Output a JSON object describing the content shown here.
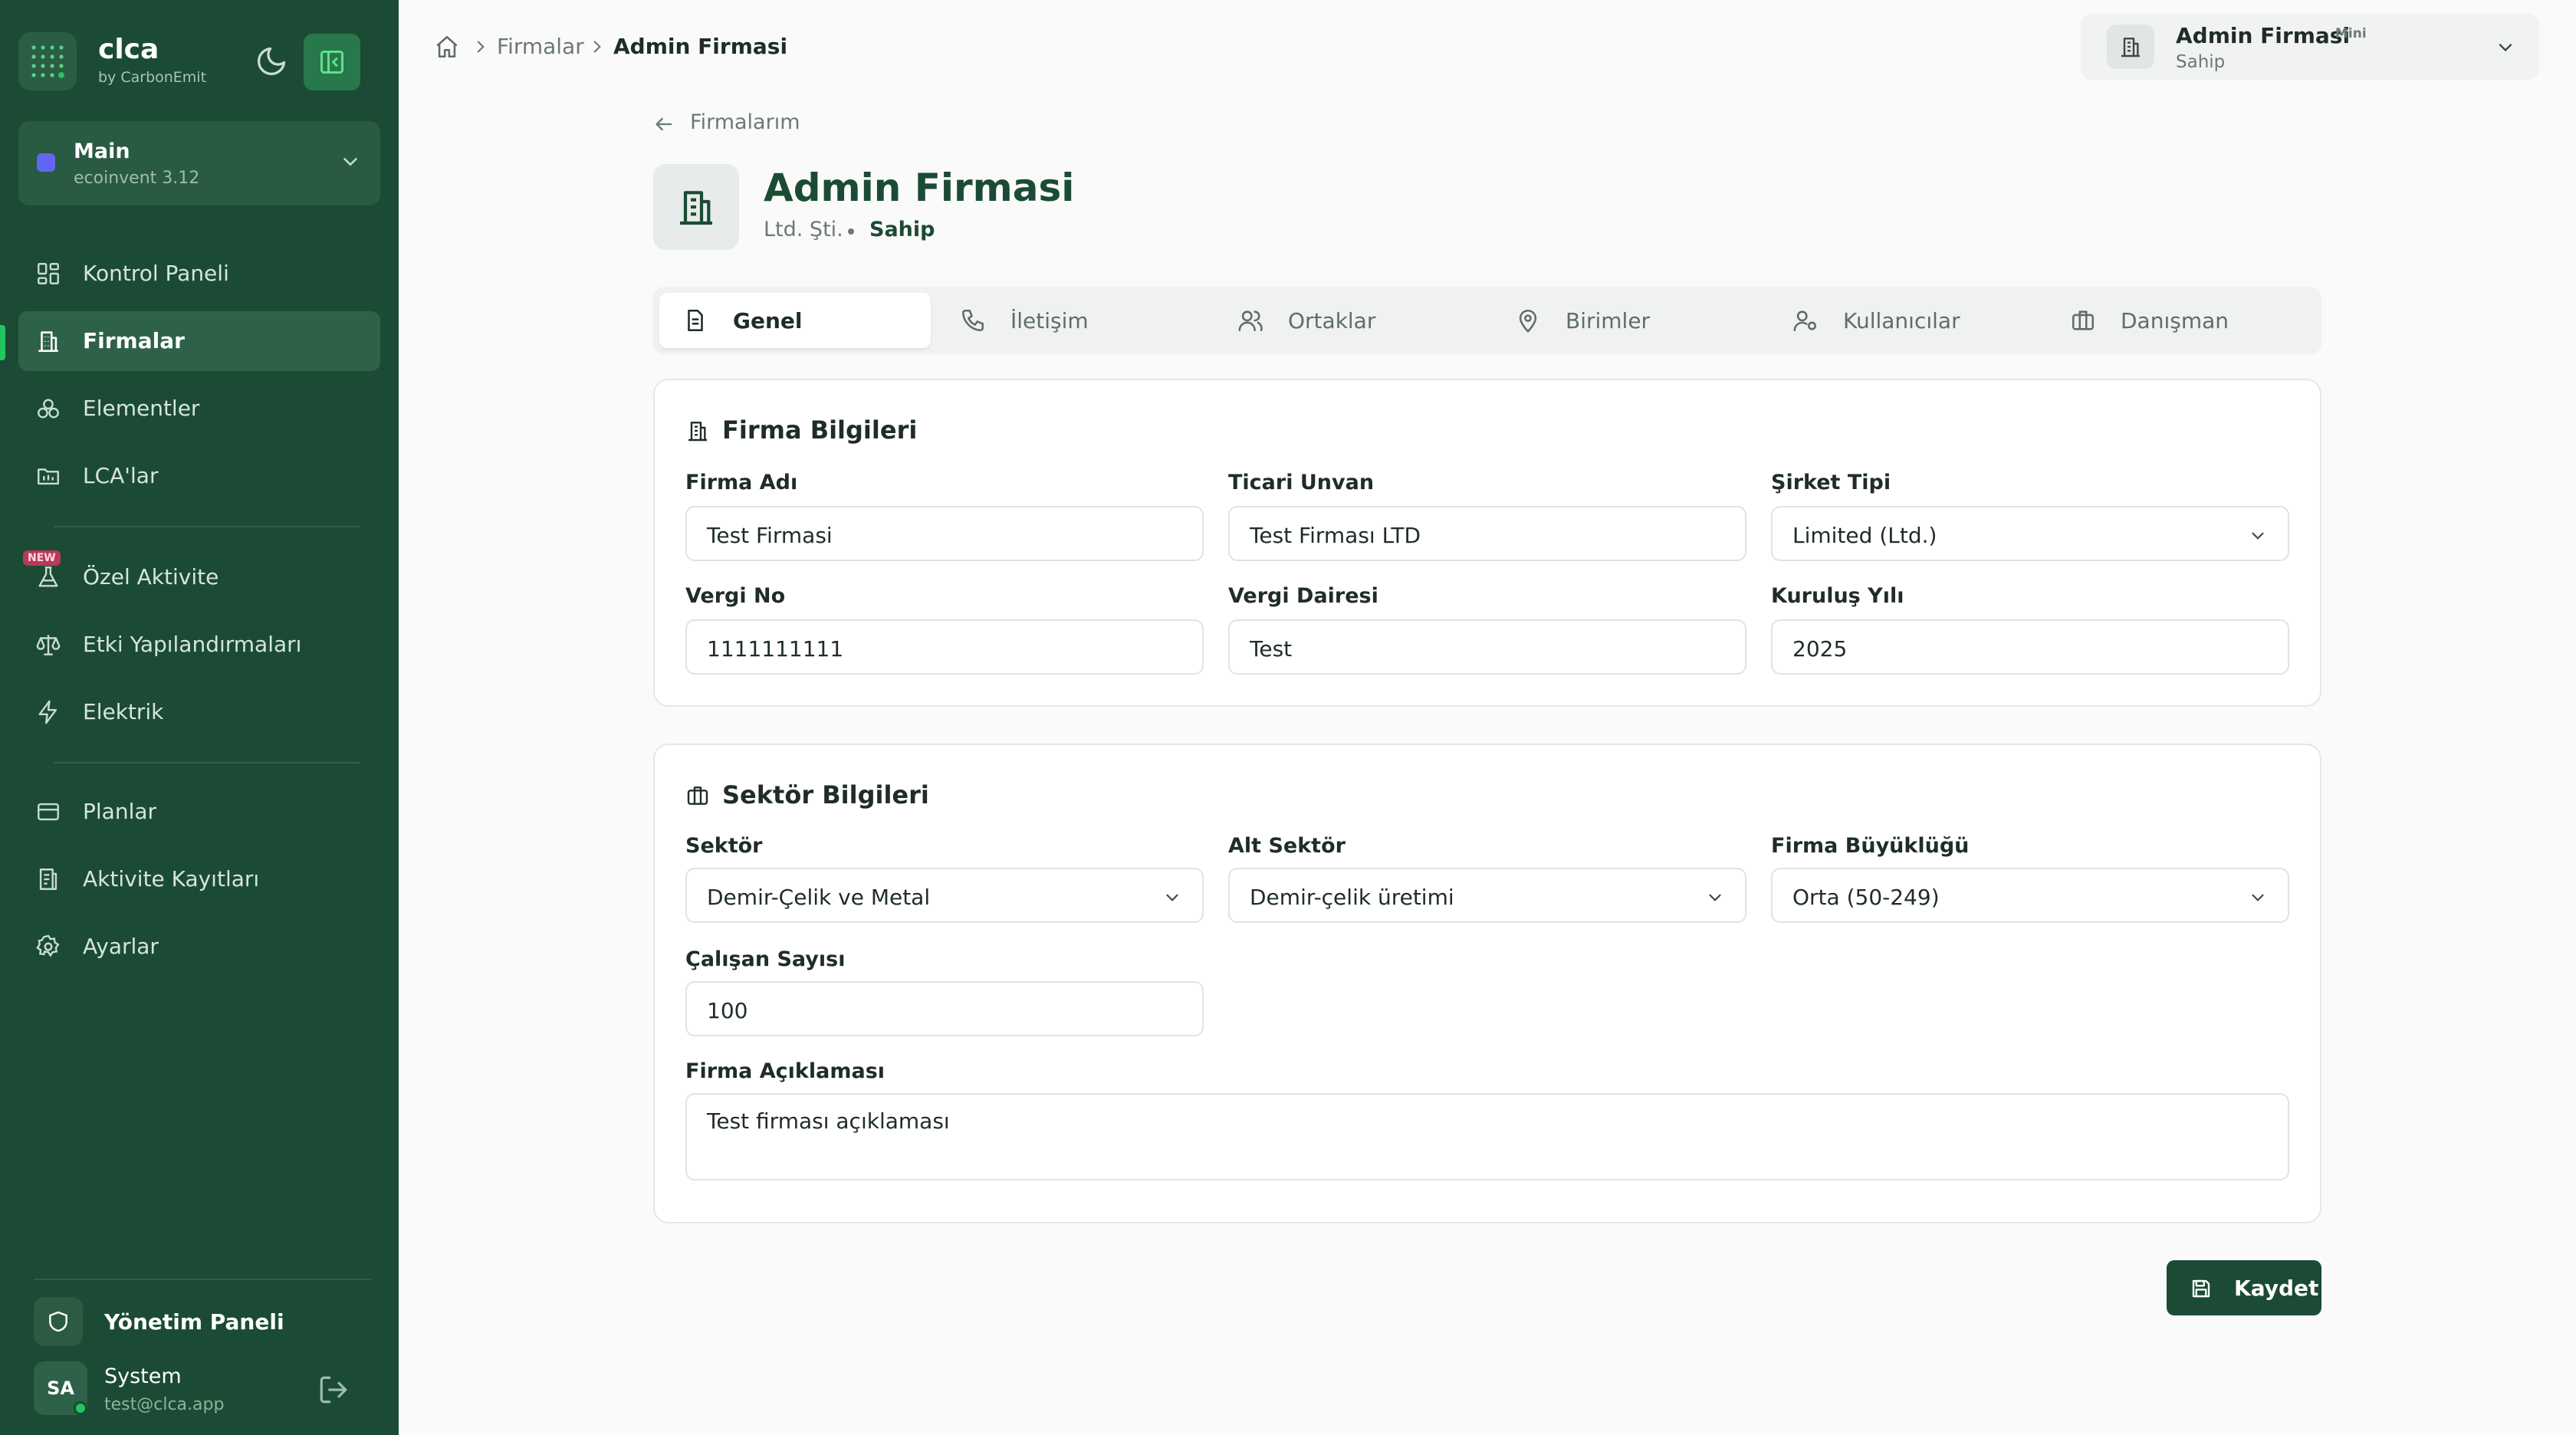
{
  "brand": {
    "name": "clca",
    "sub": "by CarbonEmit"
  },
  "database": {
    "name": "Main",
    "version": "ecoinvent 3.12"
  },
  "sidebar": {
    "items": [
      {
        "label": "Kontrol Paneli",
        "icon": "dashboard-icon"
      },
      {
        "label": "Firmalar",
        "icon": "building-icon"
      },
      {
        "label": "Elementler",
        "icon": "elements-icon"
      },
      {
        "label": "LCA'lar",
        "icon": "lca-folder-icon"
      },
      {
        "label": "Özel Aktivite",
        "icon": "flask-icon",
        "badge": "NEW"
      },
      {
        "label": "Etki Yapılandırmaları",
        "icon": "scale-icon"
      },
      {
        "label": "Elektrik",
        "icon": "bolt-icon"
      },
      {
        "label": "Planlar",
        "icon": "card-icon"
      },
      {
        "label": "Aktivite Kayıtları",
        "icon": "log-icon"
      },
      {
        "label": "Ayarlar",
        "icon": "gear-icon"
      }
    ],
    "admin_panel": "Yönetim Paneli",
    "user": {
      "initials": "SA",
      "name": "System",
      "email": "test@clca.app"
    }
  },
  "breadcrumb": {
    "parent": "Firmalar",
    "current": "Admin Firmasi"
  },
  "company_switcher": {
    "name": "Admin Firmasi",
    "plan": "Mini",
    "role": "Sahip"
  },
  "page": {
    "back_label": "Firmalarım",
    "title": "Admin Firmasi",
    "company_type": "Ltd. Şti.",
    "role": "Sahip"
  },
  "tabs": [
    {
      "label": "Genel",
      "icon": "document-icon",
      "active": true
    },
    {
      "label": "İletişim",
      "icon": "phone-icon",
      "active": false
    },
    {
      "label": "Ortaklar",
      "icon": "users-icon",
      "active": false
    },
    {
      "label": "Birimler",
      "icon": "map-pin-icon",
      "active": false
    },
    {
      "label": "Kullanıcılar",
      "icon": "user-gear-icon",
      "active": false
    },
    {
      "label": "Danışman",
      "icon": "briefcase-icon",
      "active": false
    }
  ],
  "firm_info": {
    "title": "Firma Bilgileri",
    "firm_name": {
      "label": "Firma Adı",
      "value": "Test Firmasi"
    },
    "trade_name": {
      "label": "Ticari Unvan",
      "value": "Test Firması LTD"
    },
    "company_type": {
      "label": "Şirket Tipi",
      "value": "Limited (Ltd.)"
    },
    "tax_no": {
      "label": "Vergi No",
      "value": "1111111111"
    },
    "tax_office": {
      "label": "Vergi Dairesi",
      "value": "Test"
    },
    "founded_year": {
      "label": "Kuruluş Yılı",
      "value": "2025"
    }
  },
  "sector_info": {
    "title": "Sektör Bilgileri",
    "sector": {
      "label": "Sektör",
      "value": "Demir-Çelik ve Metal"
    },
    "sub_sector": {
      "label": "Alt Sektör",
      "value": "Demir-çelik üretimi"
    },
    "firm_size": {
      "label": "Firma Büyüklüğü",
      "value": "Orta (50-249)"
    },
    "employee_count": {
      "label": "Çalışan Sayısı",
      "value": "100"
    },
    "description": {
      "label": "Firma Açıklaması",
      "value": "Test firması açıklaması"
    }
  },
  "save_label": "Kaydet",
  "colors": {
    "sidebar_bg": "#1b4b34",
    "accent": "#22c55e",
    "primary_button": "#1b4b34",
    "new_badge": "#b83a5a",
    "db_dot": "#6366f1"
  }
}
